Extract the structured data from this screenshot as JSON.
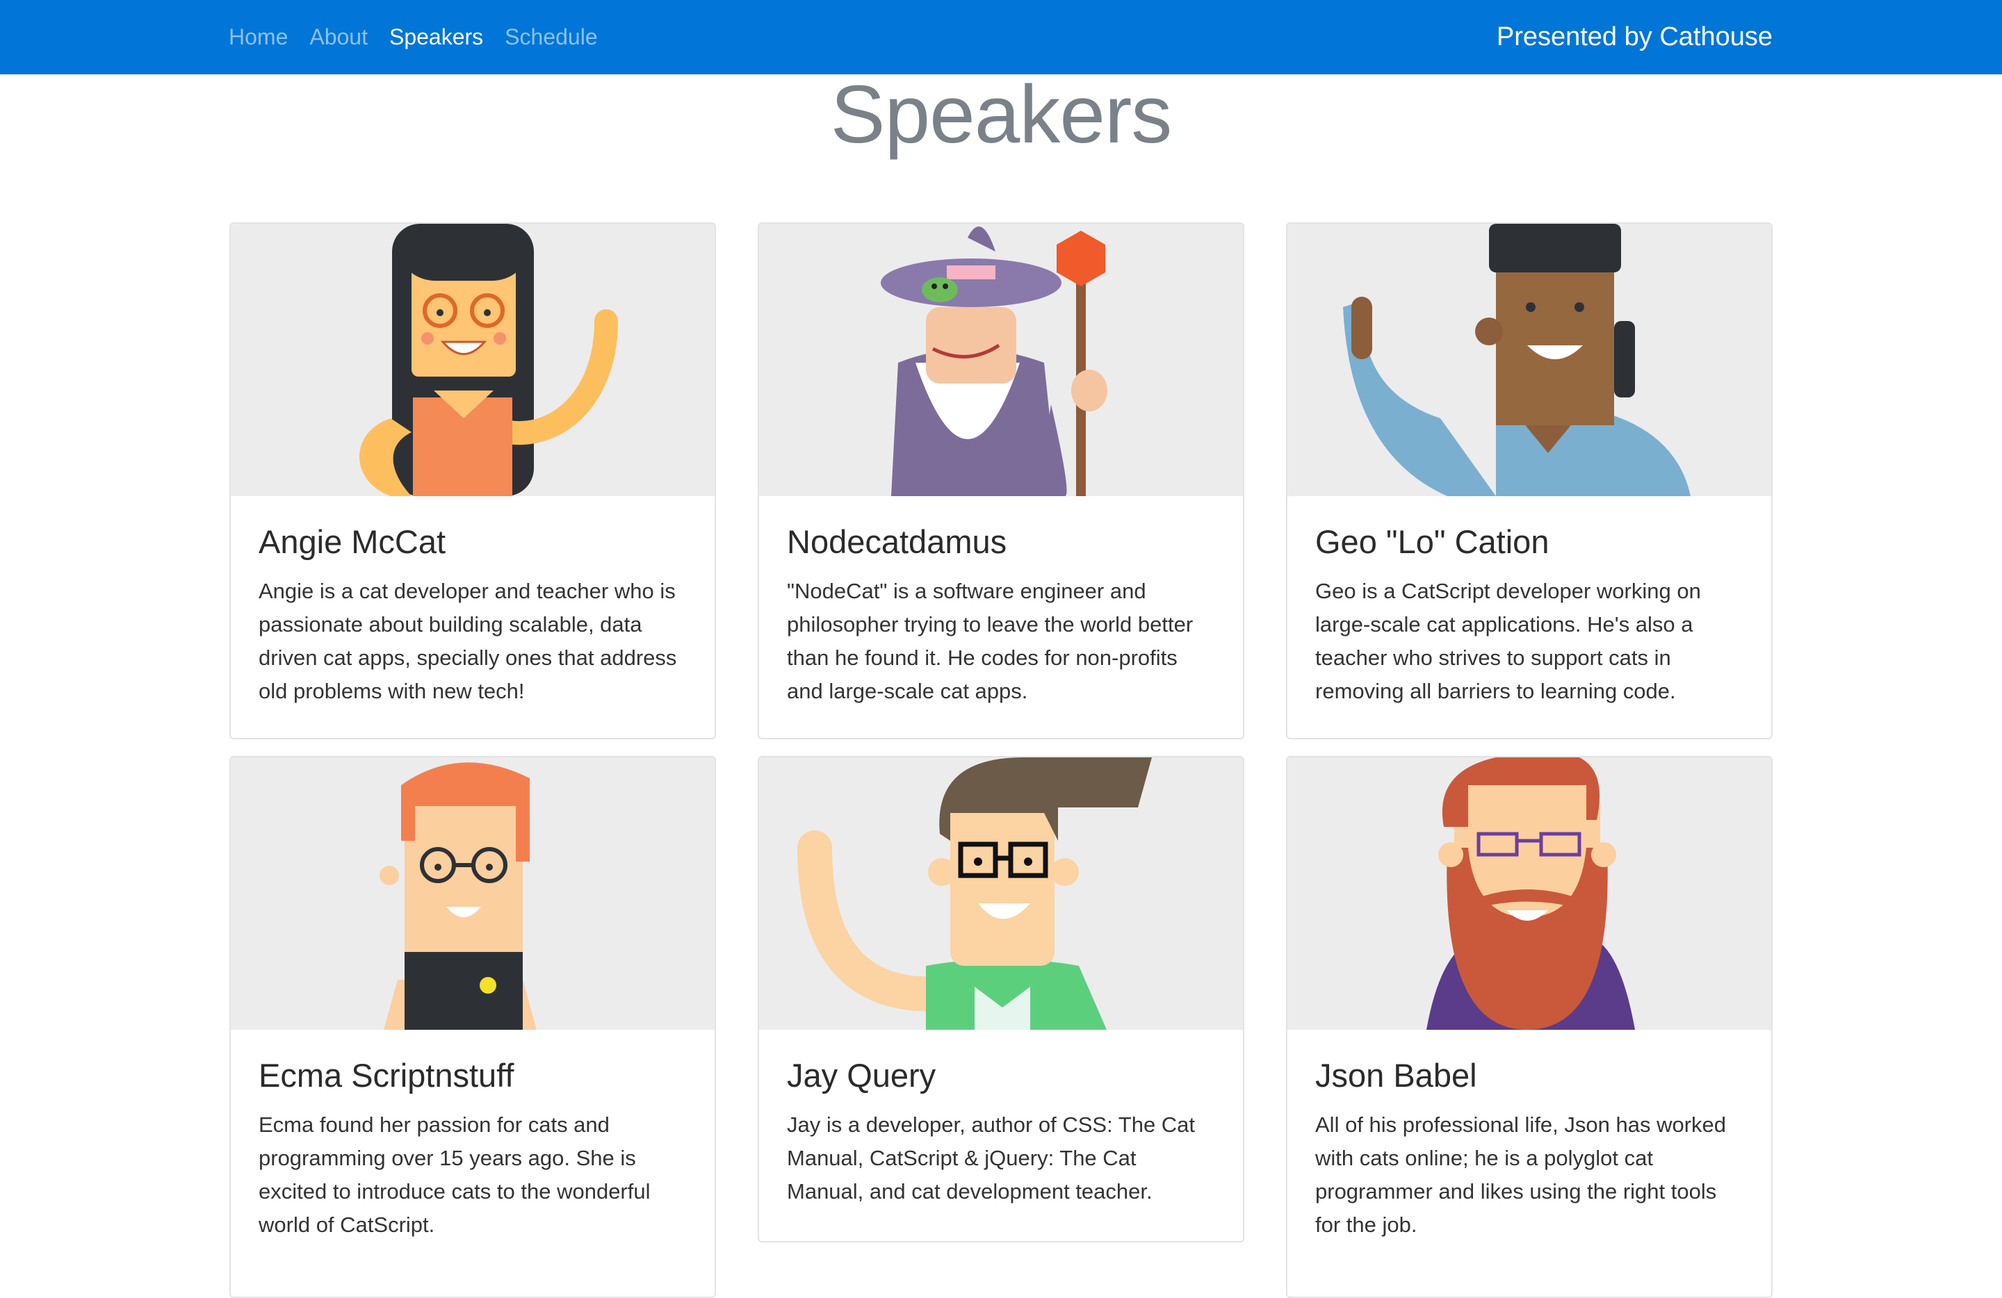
{
  "nav": {
    "links": [
      {
        "label": "Home",
        "active": false
      },
      {
        "label": "About",
        "active": false
      },
      {
        "label": "Speakers",
        "active": true
      },
      {
        "label": "Schedule",
        "active": false
      }
    ],
    "brand": "Presented by Cathouse"
  },
  "page": {
    "title": "Speakers"
  },
  "speakers": [
    {
      "name": "Angie McCat",
      "bio": "Angie is a cat developer and teacher who is passionate about building scalable, data driven cat apps, specially ones that address old problems with new tech!"
    },
    {
      "name": "Nodecatdamus",
      "bio": "\"NodeCat\" is a software engineer and philosopher trying to leave the world better than he found it. He codes for non-profits and large-scale cat apps."
    },
    {
      "name": "Geo \"Lo\" Cation",
      "bio": "Geo is a CatScript developer working on large-scale cat applications. He's also a teacher who strives to support cats in removing all barriers to learning code."
    },
    {
      "name": "Ecma Scriptnstuff",
      "bio": "Ecma found her passion for cats and programming over 15 years ago. She is excited to introduce cats to the wonderful world of CatScript."
    },
    {
      "name": "Jay Query",
      "bio": "Jay is a developer, author of CSS: The Cat Manual, CatScript & jQuery: The Cat Manual, and cat development teacher."
    },
    {
      "name": "Json Babel",
      "bio": "All of his professional life, Json has worked with cats online; he is a polyglot cat programmer and likes using the right tools for the job."
    }
  ],
  "colors": {
    "navbar": "#0275d8",
    "card_image_bg": "#ececed",
    "title": "#7a8189"
  }
}
